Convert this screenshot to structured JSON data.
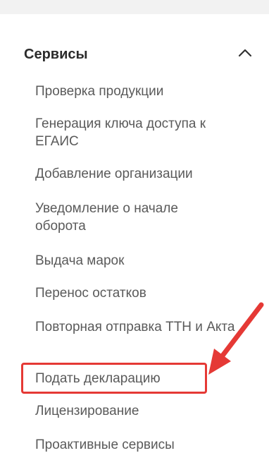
{
  "section": {
    "title": "Сервисы",
    "toggle_icon": "chevron-up-icon"
  },
  "menu": {
    "items": [
      {
        "label": "Проверка продукции"
      },
      {
        "label": "Генерация ключа доступа к ЕГАИС"
      },
      {
        "label": "Добавление организации"
      },
      {
        "label": "Уведомление о начале оборота"
      },
      {
        "label": "Выдача марок"
      },
      {
        "label": "Перенос остатков"
      },
      {
        "label": "Повторная отправка ТТН и Акта"
      },
      {
        "label": "Подать декларацию"
      },
      {
        "label": "Лицензирование"
      },
      {
        "label": "Проактивные сервисы"
      }
    ]
  },
  "annotation": {
    "color": "#e53935",
    "icon": "arrow-pointer-icon"
  }
}
